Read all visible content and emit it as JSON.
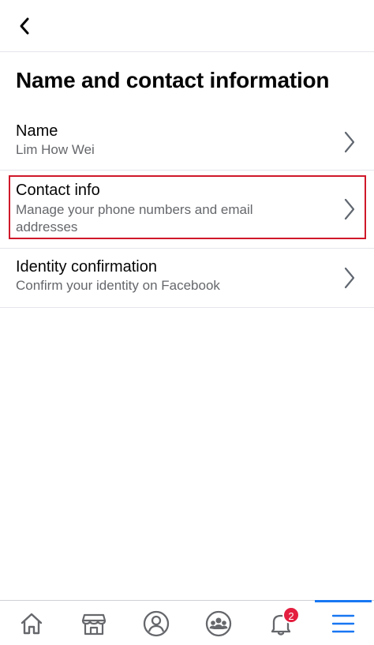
{
  "header": {
    "back_icon": "chevron-left-icon",
    "title": "Name and contact information"
  },
  "items": [
    {
      "title": "Name",
      "subtitle": "Lim How Wei"
    },
    {
      "title": "Contact info",
      "subtitle": "Manage your phone numbers and email addresses"
    },
    {
      "title": "Identity confirmation",
      "subtitle": "Confirm your identity on Facebook"
    }
  ],
  "highlight_color": "#d0182a",
  "bottom_nav": {
    "tabs": [
      {
        "name": "Home",
        "icon": "home-icon"
      },
      {
        "name": "Marketplace",
        "icon": "marketplace-icon"
      },
      {
        "name": "Profile",
        "icon": "profile-icon"
      },
      {
        "name": "Groups",
        "icon": "groups-icon"
      },
      {
        "name": "Notifications",
        "icon": "bell-icon"
      },
      {
        "name": "Menu",
        "icon": "menu-icon"
      }
    ],
    "notification_count": "2",
    "active_tab": "Menu",
    "accent_color": "#1877f2"
  }
}
